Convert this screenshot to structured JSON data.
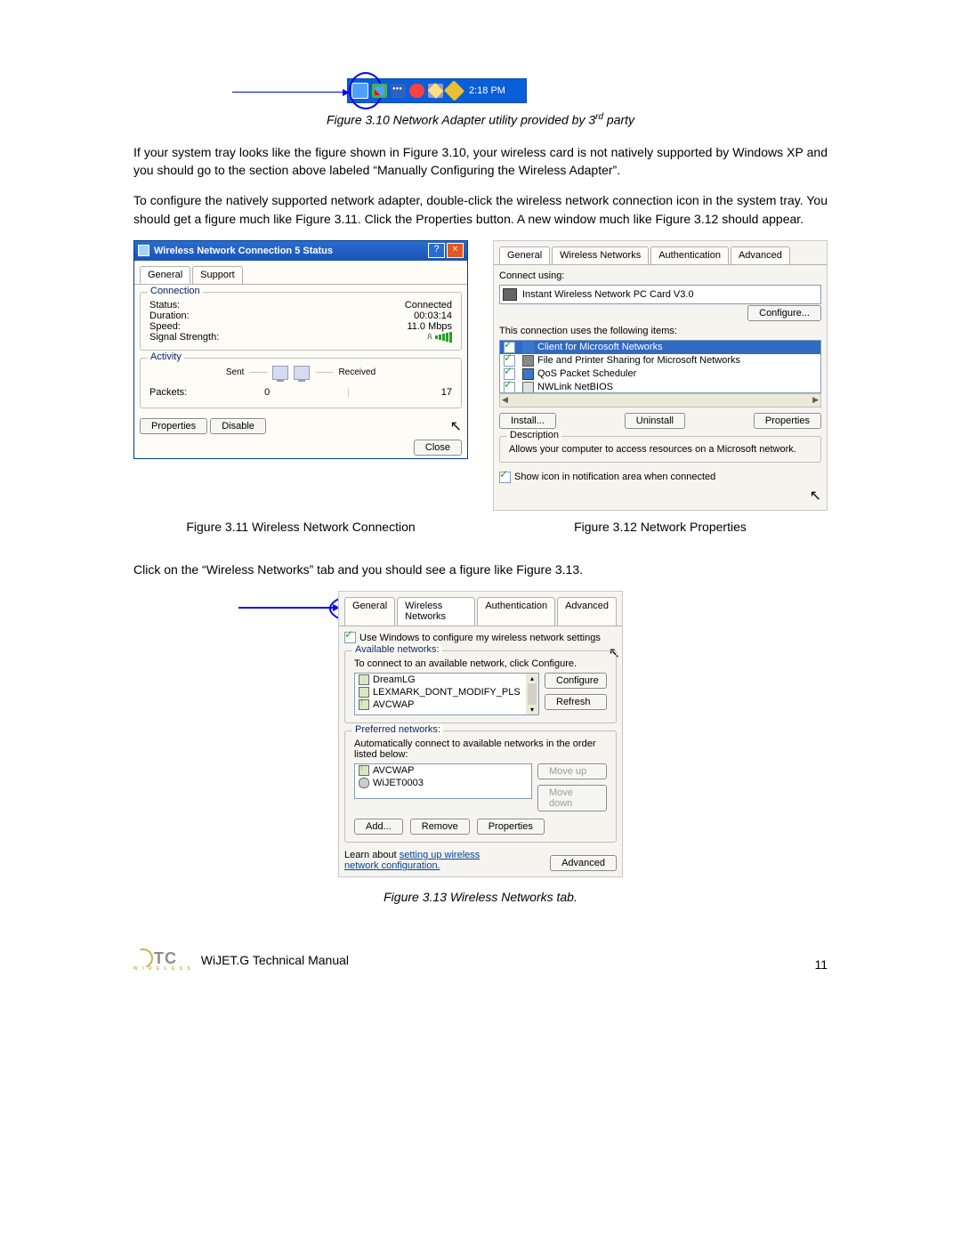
{
  "systray": {
    "time": "2:18 PM"
  },
  "fig310_caption_a": "Figure 3.10 Network Adapter utility provided by 3",
  "fig310_caption_b": " party",
  "fig310_caption_sup": "rd",
  "para1": "If your system tray looks like the figure shown in Figure 3.10, your wireless card is not natively supported by Windows XP and you should go to the section above labeled “Manually Configuring the Wireless Adapter”.",
  "para2": "To configure the natively supported network adapter, double-click the wireless network connection icon in the system tray. You should get a figure much like Figure 3.11. Click the Properties button. A new window much like Figure 3.12 should appear.",
  "fig311": {
    "title": "Wireless Network Connection 5 Status",
    "help": "?",
    "close": "×",
    "tabs": {
      "general": "General",
      "support": "Support"
    },
    "conn_label": "Connection",
    "status_l": "Status:",
    "status_v": "Connected",
    "duration_l": "Duration:",
    "duration_v": "00:03:14",
    "speed_l": "Speed:",
    "speed_v": "11.0 Mbps",
    "signal_l": "Signal Strength:",
    "act_label": "Activity",
    "sent": "Sent",
    "received": "Received",
    "packets_l": "Packets:",
    "packets_sent": "0",
    "packets_recv": "17",
    "properties_btn": "Properties",
    "disable_btn": "Disable",
    "close_btn": "Close"
  },
  "fig312": {
    "tabs": {
      "general": "General",
      "wireless": "Wireless Networks",
      "auth": "Authentication",
      "adv": "Advanced"
    },
    "connect_using": "Connect using:",
    "adapter": "Instant Wireless Network PC Card V3.0",
    "configure": "Configure...",
    "uses_items": "This connection uses the following items:",
    "items": {
      "i1": "Client for Microsoft Networks",
      "i2": "File and Printer Sharing for Microsoft Networks",
      "i3": "QoS Packet Scheduler",
      "i4": "NWLink NetBIOS"
    },
    "install": "Install...",
    "uninstall": "Uninstall",
    "properties": "Properties",
    "desc_label": "Description",
    "desc": "Allows your computer to access resources on a Microsoft network.",
    "show_icon": "Show icon in notification area when connected"
  },
  "caption311": "Figure 3.11 Wireless Network Connection",
  "caption312": "Figure 3.12 Network Properties",
  "para3": "Click on the “Wireless Networks” tab and you should see a figure like Figure 3.13.",
  "fig313": {
    "tabs": {
      "general": "General",
      "wireless": "Wireless Networks",
      "auth": "Authentication",
      "adv": "Advanced"
    },
    "use_win": "Use Windows to configure my wireless network settings",
    "avail_label": "Available networks:",
    "avail_hint": "To connect to an available network, click Configure.",
    "avail": {
      "n1": "DreamLG",
      "n2": "LEXMARK_DONT_MODIFY_PLS",
      "n3": "AVCWAP"
    },
    "configure": "Configure",
    "refresh": "Refresh",
    "pref_label": "Preferred networks:",
    "pref_hint": "Automatically connect to available networks in the order listed below:",
    "pref": {
      "p1": "AVCWAP",
      "p2": "WiJET0003"
    },
    "move_up": "Move up",
    "move_down": "Move down",
    "add": "Add...",
    "remove": "Remove",
    "properties": "Properties",
    "learn_a": "Learn about ",
    "learn_link": "setting up wireless network configuration.",
    "advanced": "Advanced"
  },
  "caption313": "Figure 3.13 Wireless Networks tab.",
  "footer_title": "WiJET.G Technical Manual",
  "page_num": "11",
  "logo": {
    "name": "OTC",
    "t": "TC",
    "sub": "W I R E L E S S"
  }
}
